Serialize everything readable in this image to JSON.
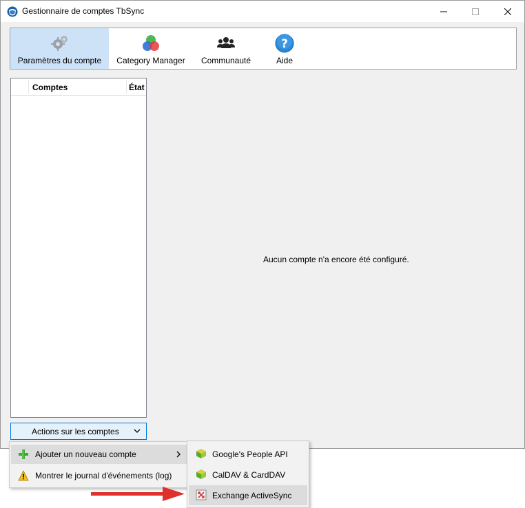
{
  "window": {
    "title": "Gestionnaire de comptes TbSync",
    "controls": {
      "minimize": "—",
      "maximize": "☐",
      "close": "✕"
    }
  },
  "toolbar": {
    "items": [
      {
        "label": "Paramètres du compte",
        "icon": "gears-icon",
        "active": true
      },
      {
        "label": "Category Manager",
        "icon": "category-manager-icon",
        "active": false
      },
      {
        "label": "Communauté",
        "icon": "community-icon",
        "active": false
      },
      {
        "label": "Aide",
        "icon": "help-icon",
        "active": false
      }
    ]
  },
  "accounts": {
    "columns": {
      "name": "Comptes",
      "state": "État"
    },
    "rows": []
  },
  "main": {
    "empty_message": "Aucun compte n'a encore été configuré."
  },
  "actions": {
    "label": "Actions sur les comptes",
    "menu": [
      {
        "label": "Ajouter un nouveau compte",
        "icon": "plus-icon",
        "has_submenu": true
      },
      {
        "label": "Montrer le journal d'événements (log)",
        "icon": "warning-icon",
        "has_submenu": false
      }
    ],
    "submenu": [
      {
        "label": "Google's People API",
        "icon": "provider-cube-icon"
      },
      {
        "label": "CalDAV & CardDAV",
        "icon": "provider-cube-icon"
      },
      {
        "label": "Exchange ActiveSync",
        "icon": "eas-icon"
      }
    ]
  },
  "colors": {
    "accent": "#0078d7",
    "active_tool": "#cde1f7",
    "arrow": "#e0302e"
  }
}
